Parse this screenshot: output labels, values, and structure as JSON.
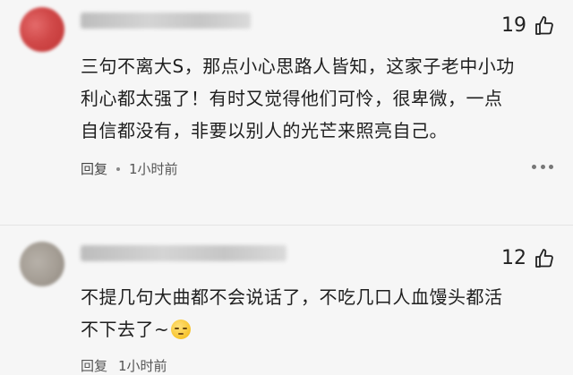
{
  "comments": [
    {
      "likes": "19",
      "text_lines": [
        "三句不离大S，那点小心思路人皆知，这家子老中小功",
        "利心都太强了！有时又觉得他们可怜，很卑微，一点",
        "自信都没有，非要以别人的光芒来照亮自己。"
      ],
      "reply_label": "回复",
      "time": "1小时前"
    },
    {
      "likes": "12",
      "text_lines": [
        "不提几句大曲都不会说话了，不吃几口人血馒头都活",
        "不下去了~"
      ],
      "emoji": "pleading-face-emoji",
      "reply_label": "回复",
      "time": "1小时前"
    }
  ],
  "icons": {
    "like": "thumbs-up-icon",
    "more": "more-dots-icon"
  },
  "colors": {
    "background": "#f6f6f6",
    "text": "#1f1f1f",
    "meta": "#444444"
  }
}
